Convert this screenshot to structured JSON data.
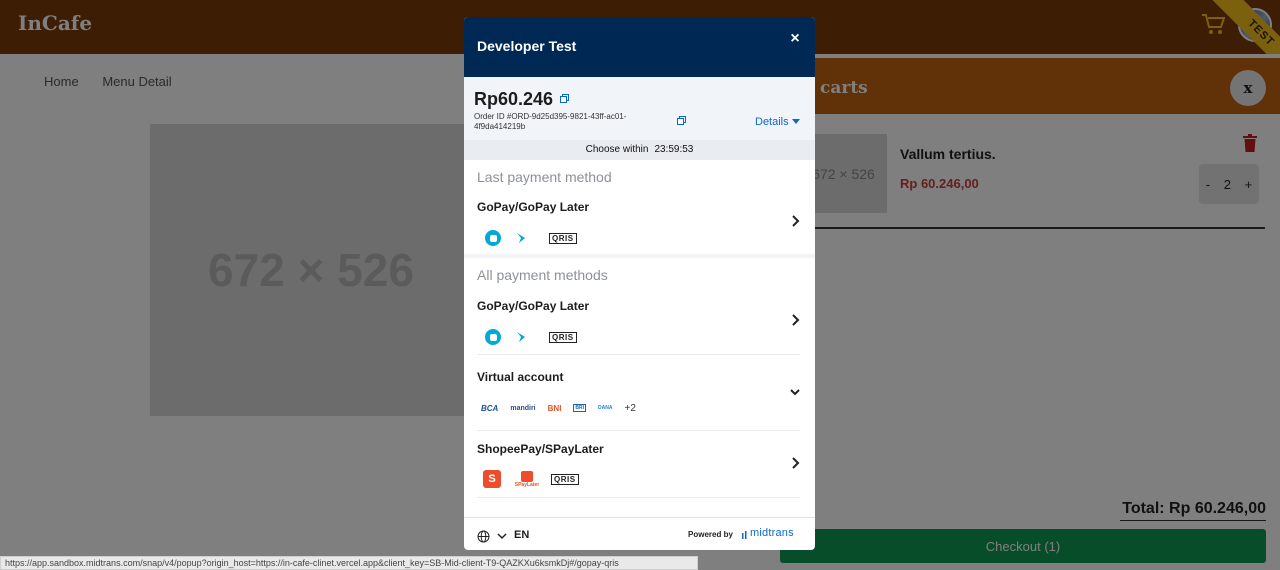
{
  "app": {
    "brand": "InCafe",
    "test_ribbon": "TEST",
    "breadcrumb": [
      "Home",
      "Menu Detail"
    ],
    "product_image_label": "672 × 526"
  },
  "cart": {
    "title": "carts",
    "close_label": "x",
    "item": {
      "image_label": "672 × 526",
      "name": "Vallum tertius.",
      "price": "Rp 60.246,00",
      "quantity": "2",
      "minus": "-",
      "plus": "+"
    },
    "total": "Total: Rp 60.246,00",
    "checkout_label": "Checkout (1)"
  },
  "status_bar": "https://app.sandbox.midtrans.com/snap/v4/popup?origin_host=https://in-cafe-clinet.vercel.app&client_key=SB-Mid-client-T9-QAZKXu6ksmkDj#/gopay-qris",
  "modal": {
    "merchant_name": "Developer Test",
    "close_label": "×",
    "amount": "Rp60.246",
    "order_id": "Order ID #ORD-9d25d395-9821-43ff-ac01-4f9da414219b",
    "details_label": "Details",
    "countdown_label": "Choose within",
    "countdown_value": "23:59:53",
    "last_section_title": "Last payment method",
    "all_section_title": "All payment methods",
    "last_method": {
      "label": "GoPay/GoPay Later",
      "logos": [
        "gopay-logo",
        "gopay-later-logo",
        "qris-logo"
      ]
    },
    "methods": [
      {
        "label": "GoPay/GoPay Later",
        "logos": [
          "gopay-logo",
          "gopay-later-logo",
          "qris-logo"
        ],
        "expand": "chevron-right"
      },
      {
        "label": "Virtual account",
        "banks": [
          "BCA",
          "mandiri",
          "BNI",
          "BRI",
          "DANA"
        ],
        "more": "+2",
        "expand": "chevron-down"
      },
      {
        "label": "ShopeePay/SPayLater",
        "logos": [
          "shopeepay-logo",
          "spaylater-logo",
          "qris-logo"
        ],
        "expand": "chevron-right"
      }
    ],
    "qris_text": "QRIS",
    "spaylater_text": "SPayLater",
    "shopee_letter": "S",
    "language": "EN",
    "powered_by": "Powered by",
    "provider": "midtrans"
  },
  "colors": {
    "topbar": "#7a3a06",
    "cart_header": "#c2620f",
    "modal_header": "#002855",
    "checkout": "#0f9b55",
    "price": "#d23b3b",
    "link": "#0b68c8"
  }
}
